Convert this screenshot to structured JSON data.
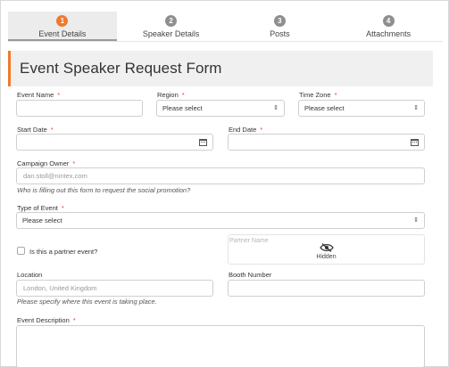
{
  "stepper": {
    "steps": [
      {
        "num": "1",
        "label": "Event Details"
      },
      {
        "num": "2",
        "label": "Speaker Details"
      },
      {
        "num": "3",
        "label": "Posts"
      },
      {
        "num": "4",
        "label": "Attachments"
      }
    ]
  },
  "form": {
    "title": "Event Speaker Request Form",
    "required_mark": "*",
    "event_name": {
      "label": "Event Name",
      "value": ""
    },
    "region": {
      "label": "Region",
      "selected": "Please select"
    },
    "time_zone": {
      "label": "Time Zone",
      "selected": "Please select"
    },
    "start_date": {
      "label": "Start Date",
      "value": ""
    },
    "end_date": {
      "label": "End Date",
      "value": ""
    },
    "campaign_owner": {
      "label": "Campaign Owner",
      "value": "dan.stoll@nintex.com",
      "help": "Who is filling out this form to request the social promotion?"
    },
    "type_of_event": {
      "label": "Type of Event",
      "selected": "Please select"
    },
    "partner_event": {
      "label": "Is this a partner event?"
    },
    "partner_name": {
      "label": "Partner Name",
      "status": "Hidden"
    },
    "location": {
      "label": "Location",
      "placeholder": "London, United Kingdom",
      "help": "Please specify where this event is taking place."
    },
    "booth_number": {
      "label": "Booth Number",
      "value": ""
    },
    "event_description": {
      "label": "Event Description",
      "value": ""
    }
  },
  "colors": {
    "accent": "#f07a2c",
    "required": "#e7451e"
  },
  "icons": {
    "select_arrows": "updown-icon",
    "calendar": "calendar-icon",
    "hidden": "eye-slash-icon"
  }
}
